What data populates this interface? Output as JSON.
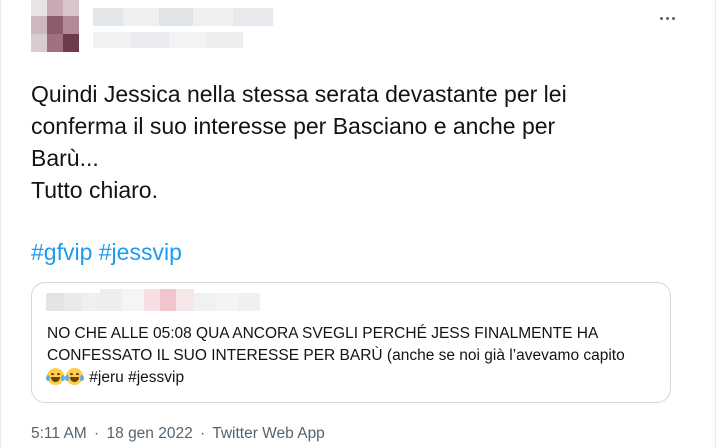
{
  "tweet": {
    "text_lines": [
      "Quindi Jessica nella stessa serata devastante per lei",
      "conferma il suo interesse per Basciano e anche per",
      "Barù...",
      "Tutto chiaro."
    ],
    "hashtags": [
      "#gfvip",
      "#jessvip"
    ],
    "more_icon": "more-horizontal-icon"
  },
  "quote": {
    "text_lines": [
      "NO CHE ALLE 05:08 QUA ANCORA SVEGLI PERCHÉ JESS FINALMENTE HA",
      "CONFESSATO IL SUO INTERESSE PER BARÙ (anche se noi già l’avevamo capito"
    ],
    "last_line_suffix": " #jeru #jessvip",
    "emoji": "face-with-tears-of-joy-icon"
  },
  "meta": {
    "time": "5:11 AM",
    "separator": "·",
    "date": "18 gen 2022",
    "source": "Twitter Web App"
  },
  "colors": {
    "text": "#0f1419",
    "secondary": "#536471",
    "link": "#1d9bf0",
    "border": "#cfd9de"
  }
}
